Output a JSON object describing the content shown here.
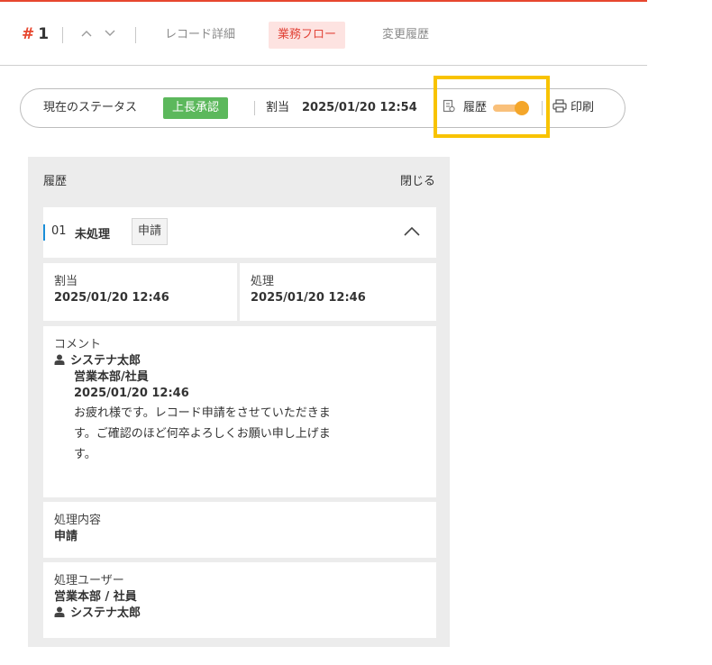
{
  "header": {
    "hash": "#",
    "record_number": "1",
    "prev_icon": "chevron-up-icon",
    "next_icon": "chevron-down-icon",
    "tabs": [
      {
        "label": "レコード詳細",
        "active": false
      },
      {
        "label": "業務フロー",
        "active": true
      },
      {
        "label": "変更履歴",
        "active": false
      }
    ]
  },
  "status_bar": {
    "status_label": "現在のステータス",
    "status_value": "上長承認",
    "assign_label": "割当",
    "assign_date": "2025/01/20 12:54",
    "history_label": "履歴",
    "history_toggle_on": true,
    "print_label": "印刷"
  },
  "history_panel": {
    "title": "履歴",
    "close_label": "閉じる",
    "step": {
      "number": "01",
      "name": "未処理",
      "action_tag": "申請",
      "assign_label": "割当",
      "assign_date": "2025/01/20 12:46",
      "process_label": "処理",
      "process_date": "2025/01/20 12:46",
      "comment_label": "コメント",
      "comment_user": "システナ太郎",
      "comment_dept": "営業本部/社員",
      "comment_date": "2025/01/20 12:46",
      "comment_lines": [
        "お疲れ様です。レコード申請をさせていただきま",
        "す。ご確認のほど何卒よろしくお願い申し上げま",
        "す。"
      ],
      "content_label": "処理内容",
      "content_value": "申請",
      "process_user_label": "処理ユーザー",
      "process_user_dept": "営業本部 / 社員",
      "process_user_name": "システナ太郎"
    }
  },
  "colors": {
    "accent": "#e7472f",
    "status_green": "#5cb85c",
    "toggle_orange": "#f4a62a",
    "highlight_yellow": "#f8c300",
    "step_bar_blue": "#1a8ed8"
  }
}
